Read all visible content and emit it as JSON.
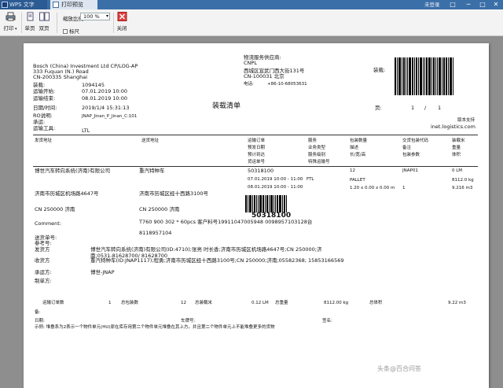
{
  "titlebar": {
    "app_tab": "WPS 文字",
    "doc_tab": "打印预览",
    "login": "未登录",
    "controls": [
      "□",
      "─",
      "□",
      "✕"
    ]
  },
  "toolbar": {
    "print": "打印",
    "single_page": "单页",
    "double_page": "双页",
    "zoom_label": "缩放比例:",
    "zoom_value": "100 %",
    "ruler": "标尺",
    "close": "关闭"
  },
  "doc": {
    "company_lines": [
      "Bosch (China) Investment Ltd CP/LOG-AP",
      "333 Fuquan (N.) Road",
      "CN-200335 Shanghai"
    ],
    "provider_label": "物流服务供应商:",
    "provider_lines": [
      "CNPL",
      "西城区宣武门西大街131号",
      "CN-100031 北京"
    ],
    "phone_label": "电话:",
    "phone_value": "+86-10-68053631",
    "loading_label": "装载:",
    "fields": [
      {
        "label": "装载:",
        "value": "1094145"
      },
      {
        "label": "运输开始:",
        "value": "07.01.2019 10:00"
      },
      {
        "label": "运输结束:",
        "value": "08.01.2019 10:00"
      },
      {
        "label": "日期/时间:",
        "value": "2019/1/4 15:31:13"
      },
      {
        "label": "RO说明:",
        "value": "JNAP_Jinan_P_Jinan_C:101"
      },
      {
        "label": "承运:",
        "value": ""
      },
      {
        "label": "运输工具:",
        "value": "LTL"
      }
    ],
    "doc_title": "装载清单",
    "page_label": "页:",
    "page_current": "1",
    "page_sep": "/",
    "page_total": "1",
    "provider_ver": "版本支持",
    "provider_site": "inet.logistics.com",
    "table_headers": {
      "col1": "发货地址",
      "col2": "送货地址",
      "col3": [
        "运输订单",
        "预发日期",
        "预计到达",
        "货运单号"
      ],
      "col4": [
        "服务",
        "业务类型",
        "服务级别",
        "特殊运输号"
      ],
      "col5": [
        "包装数量",
        "描述",
        "长/宽/高"
      ],
      "col6": [
        "交货包装代码",
        "备注",
        "包装参数"
      ],
      "col7": [
        "装载米",
        "重量",
        "体积"
      ]
    },
    "row": {
      "shipper": "博世汽车转向系统(济南)有限公司",
      "consignee": "重汽特种车",
      "shipper_addr": "济南市历城区机场路4647号",
      "consignee_addr": "济南市历城区经十西路3100号",
      "shipper_city": "CN 250000 济南",
      "consignee_city": "CN 250000 济南",
      "order": "50318100",
      "pickup": "07.01.2019 10:00 - 11:00",
      "service": "FTL",
      "delivery": "08.01.2019 10:00 - 11:00",
      "qty": "12",
      "pkg_code": "JNAP01",
      "desc": "PALLET",
      "pkg_qty": "1",
      "dims": "1.20 x 0.00 x 0.00 m",
      "ldm": "0 LM",
      "weight": "8112.0 kg",
      "volume": "9.216 m3"
    },
    "comment_label": "Comment:",
    "comment_value": "T760 900 302 * 60pcs 客户料号19911047005948 0098957103128台",
    "barcode_number": "50318100",
    "extra_number": "8118957104",
    "deliver_label": "送货单号:",
    "ref_label": "参考号:",
    "sender_label": "发货方",
    "sender_value": "博世汽车转向系统(济南)有限公司(ID:4710);张亮 时长香;济南市历城区机场路4647号;CN 250000;济南;0531-81628700/ 81628700",
    "receiver_label": "收货方",
    "receiver_value": "重汽特种车(ID:JNAP1117);程勇;济南市历城区经十西路3100号;CN 250000;济南;05582368; 15853166569",
    "carrier_label": "承运方:",
    "carrier_value": "博世-JNAP",
    "maker_label": "制单方:",
    "summary": [
      {
        "label": "运输订单数",
        "value": "1"
      },
      {
        "label": "总包装数",
        "value": "12"
      },
      {
        "label": "总装载米",
        "value": "0.12 LM"
      },
      {
        "label": "总重量",
        "value": "8112.00 kg"
      },
      {
        "label": "总体积",
        "value": "9.22 m3"
      }
    ],
    "remarks_label": "备:",
    "date_label": "日期:",
    "plate_label": "车牌号:",
    "sign_label": "签名:",
    "footnote": "示例: 堆叠系为2表示一个物件单元(HU)原在库存用第二个物件单元堆叠在其上方。并且第二个物件单元上不能堆叠更多的货物"
  },
  "watermark": "头条@百合问答"
}
